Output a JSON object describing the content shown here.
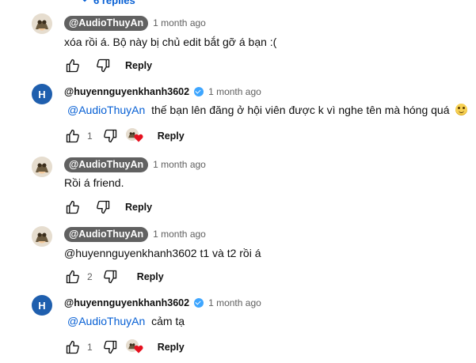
{
  "partial_top": {
    "replies_label": "6 replies"
  },
  "comments": [
    {
      "author": "@AudioThuyAn",
      "time": "1 month ago",
      "text": "xóa rồi á. Bộ này bị chủ edit bắt gỡ á bạn :(",
      "likes": "",
      "reply_label": "Reply"
    },
    {
      "author": "@huyennguyenkhanh3602",
      "avatar_letter": "H",
      "time": "1 month ago",
      "mention": "@AudioThuyAn",
      "text": "thế bạn lên đăng ở hội viên được k vì nghe tên mà hóng quá",
      "likes": "1",
      "reply_label": "Reply"
    },
    {
      "author": "@AudioThuyAn",
      "time": "1 month ago",
      "text": "Rồi á friend.",
      "likes": "",
      "reply_label": "Reply"
    },
    {
      "author": "@AudioThuyAn",
      "time": "1 month ago",
      "text": "@huyennguyenkhanh3602 t1 và t2 rồi á",
      "likes": "2",
      "reply_label": "Reply"
    },
    {
      "author": "@huyennguyenkhanh3602",
      "avatar_letter": "H",
      "time": "1 month ago",
      "mention": "@AudioThuyAn",
      "text": "cảm tạ",
      "likes": "1",
      "reply_label": "Reply"
    }
  ],
  "colors": {
    "chip_bg": "#616161",
    "link": "#065fd4",
    "verified": "#3ea6ff",
    "avatar_letter_bg": "#1f5fae",
    "heart": "#e5101e"
  },
  "icons": [
    "chevron-down-icon",
    "like-icon",
    "dislike-icon",
    "verified-icon",
    "creator-heart-icon",
    "smile-emoji-icon"
  ]
}
